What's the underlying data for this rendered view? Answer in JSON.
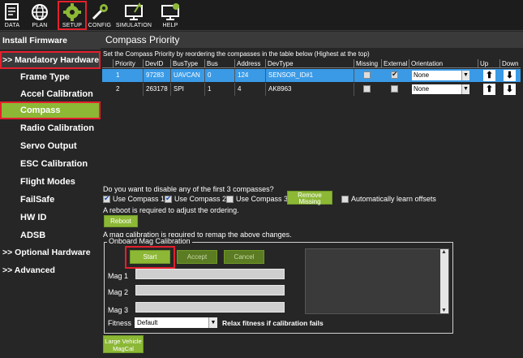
{
  "toolbar": {
    "items": [
      {
        "label": "DATA",
        "icon": "data-icon"
      },
      {
        "label": "PLAN",
        "icon": "globe-icon"
      },
      {
        "label": "SETUP",
        "icon": "setup-gear-icon"
      },
      {
        "label": "CONFIG",
        "icon": "wrench-icon"
      },
      {
        "label": "SIMULATION",
        "icon": "simulation-monitor-icon"
      },
      {
        "label": "HELP",
        "icon": "help-monitor-icon"
      }
    ]
  },
  "sidebar": {
    "install_firmware": "Install Firmware",
    "mandatory": ">> Mandatory Hardware",
    "frame_type": "Frame Type",
    "accel": "Accel Calibration",
    "compass": "Compass",
    "radio": "Radio Calibration",
    "servo": "Servo Output",
    "esc": "ESC Calibration",
    "flight_modes": "Flight Modes",
    "failsafe": "FailSafe",
    "hwid": "HW ID",
    "adsb": "ADSB",
    "optional": ">> Optional Hardware",
    "advanced": ">> Advanced"
  },
  "main": {
    "title": "Compass Priority",
    "description": "Set the Compass Priority by reordering the compasses in the table below (Highest at the top)"
  },
  "table": {
    "headers": [
      "Priority",
      "DevID",
      "BusType",
      "Bus",
      "Address",
      "DevType",
      "Missing",
      "External",
      "Orientation",
      "Up",
      "Down"
    ],
    "rows": [
      {
        "priority": "1",
        "devid": "97283",
        "bustype": "UAVCAN",
        "bus": "0",
        "address": "124",
        "devtype": "SENSOR_ID#1",
        "missing": false,
        "external": true,
        "orientation": "None"
      },
      {
        "priority": "2",
        "devid": "263178",
        "bustype": "SPI",
        "bus": "1",
        "address": "4",
        "devtype": "AK8963",
        "missing": false,
        "external": false,
        "orientation": "None"
      }
    ]
  },
  "options": {
    "question": "Do you want to disable any of the first 3 compasses?",
    "use1": "Use Compass 1",
    "use2": "Use Compass 2",
    "use3": "Use Compass 3",
    "remove_missing": "Remove Missing",
    "auto_learn": "Automatically learn offsets",
    "reboot_note": "A reboot is required to adjust the ordering.",
    "reboot": "Reboot",
    "mag_note": "A mag calibration is required to remap the above changes."
  },
  "calibration": {
    "group_title": "Onboard Mag Calibration",
    "start": "Start",
    "accept": "Accept",
    "cancel": "Cancel",
    "mag1": "Mag 1",
    "mag2": "Mag 2",
    "mag3": "Mag 3",
    "fitness_label": "Fitness",
    "fitness_value": "Default",
    "relax": "Relax fitness if calibration fails",
    "large_vehicle": "Large Vehicle MagCal"
  }
}
